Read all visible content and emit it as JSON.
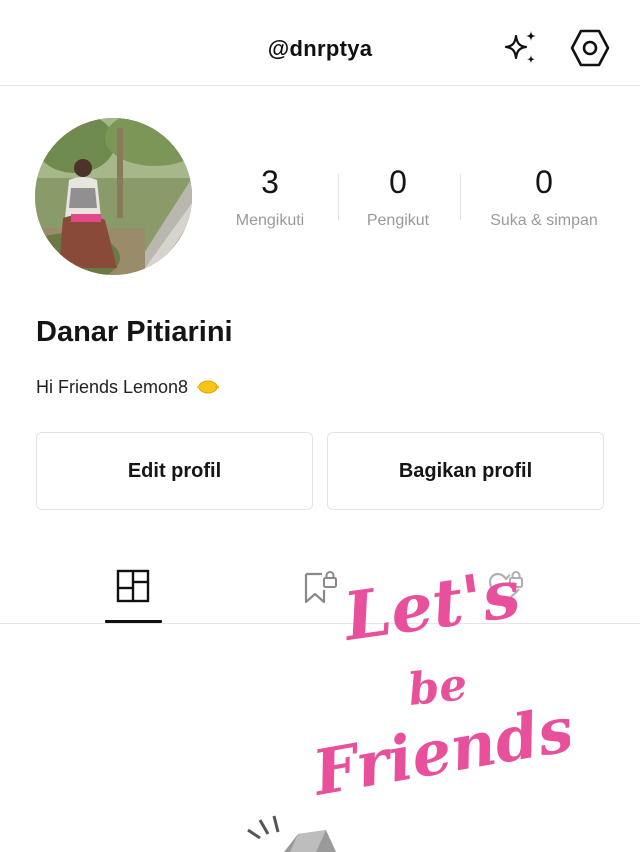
{
  "header": {
    "username": "@dnrptya",
    "sparkle_icon": "sparkle-icon",
    "settings_icon": "hexagon-settings-icon"
  },
  "profile": {
    "display_name": "Danar Pitiarini",
    "bio": "Hi Friends Lemon8",
    "bio_emoji": "lemon-icon"
  },
  "stats": [
    {
      "value": "3",
      "label": "Mengikuti"
    },
    {
      "value": "0",
      "label": "Pengikut"
    },
    {
      "value": "0",
      "label": "Suka & simpan"
    }
  ],
  "actions": {
    "edit_label": "Edit profil",
    "share_label": "Bagikan profil"
  },
  "tabs": [
    {
      "name": "posts",
      "icon": "grid-layout-icon",
      "active": true
    },
    {
      "name": "saved",
      "icon": "bookmark-lock-icon",
      "active": false
    },
    {
      "name": "liked",
      "icon": "heart-lock-icon",
      "active": false
    }
  ],
  "sticker": {
    "line1": "Let's",
    "line2": "be",
    "line3": "Friends",
    "color": "#e9509b"
  }
}
